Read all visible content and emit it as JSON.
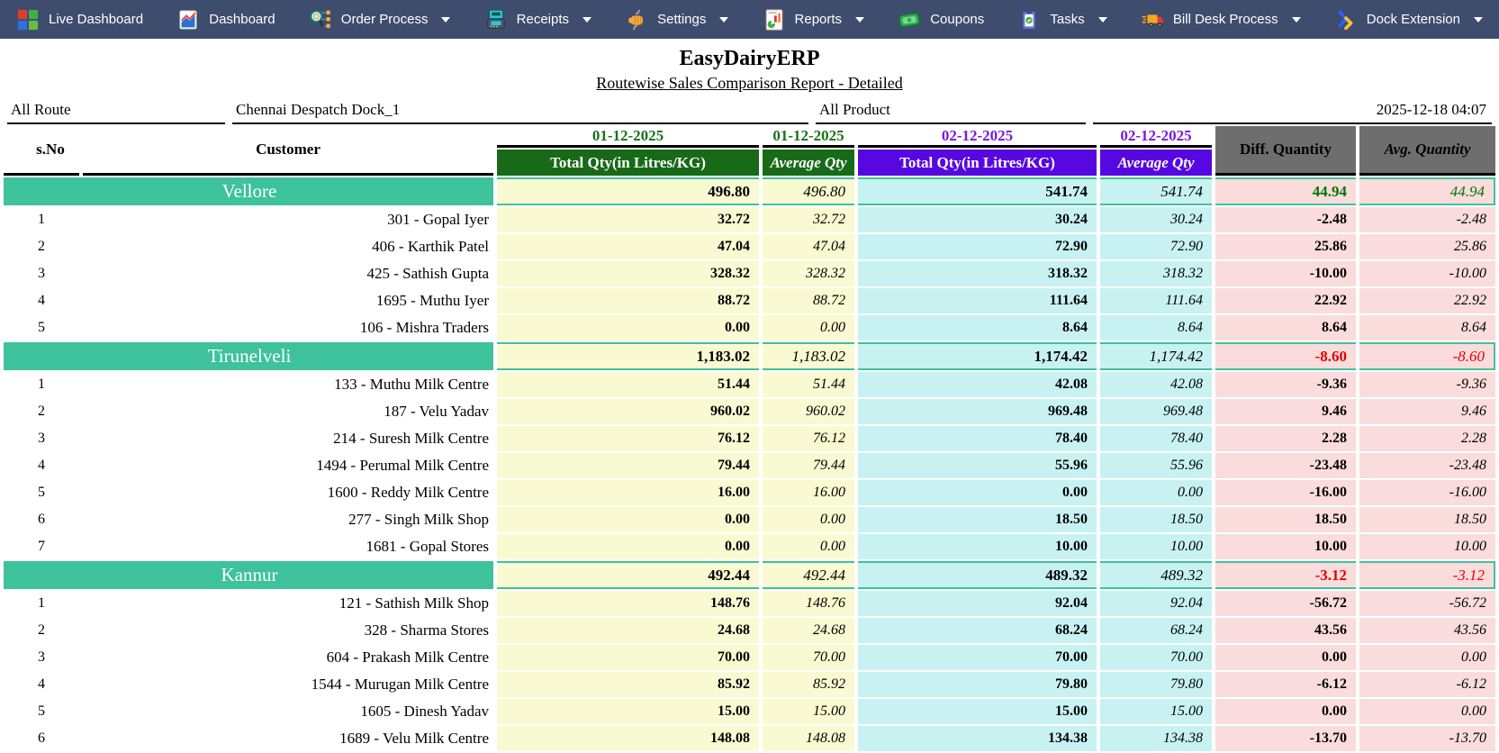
{
  "nav": {
    "items": [
      {
        "label": "Live Dashboard",
        "icon": "live-dashboard-icon",
        "caret": false
      },
      {
        "label": "Dashboard",
        "icon": "dashboard-icon",
        "caret": false
      },
      {
        "label": "Order Process",
        "icon": "order-process-icon",
        "caret": true
      },
      {
        "label": "Receipts",
        "icon": "receipts-icon",
        "caret": true
      },
      {
        "label": "Settings",
        "icon": "settings-icon",
        "caret": true
      },
      {
        "label": "Reports",
        "icon": "reports-icon",
        "caret": true
      },
      {
        "label": "Coupons",
        "icon": "coupons-icon",
        "caret": false
      },
      {
        "label": "Tasks",
        "icon": "tasks-icon",
        "caret": true
      },
      {
        "label": "Bill Desk Process",
        "icon": "bill-desk-icon",
        "caret": true
      },
      {
        "label": "Dock Extension",
        "icon": "dock-extension-icon",
        "caret": true
      }
    ]
  },
  "report": {
    "title": "EasyDairyERP",
    "subtitle": "Routewise Sales Comparison Report - Detailed",
    "filters": {
      "route": "All Route",
      "dock": "Chennai Despatch Dock_1",
      "product": "All Product",
      "datetime": "2025-12-18 04:07"
    },
    "table": {
      "headers": {
        "sno": "s.No",
        "customer": "Customer",
        "date1": "01-12-2025",
        "date2": "02-12-2025",
        "total_qty": "Total Qty(in Litres/KG)",
        "average_qty": "Average Qty",
        "diff_quantity": "Diff. Quantity",
        "avg_quantity": "Avg. Quantity"
      },
      "groups": [
        {
          "route": "Vellore",
          "totals": [
            "496.80",
            "496.80",
            "541.74",
            "541.74",
            "44.94",
            "44.94"
          ],
          "rows": [
            {
              "sno": "1",
              "customer": "301 - Gopal Iyer",
              "values": [
                "32.72",
                "32.72",
                "30.24",
                "30.24",
                "-2.48",
                "-2.48"
              ]
            },
            {
              "sno": "2",
              "customer": "406 - Karthik Patel",
              "values": [
                "47.04",
                "47.04",
                "72.90",
                "72.90",
                "25.86",
                "25.86"
              ]
            },
            {
              "sno": "3",
              "customer": "425 - Sathish Gupta",
              "values": [
                "328.32",
                "328.32",
                "318.32",
                "318.32",
                "-10.00",
                "-10.00"
              ]
            },
            {
              "sno": "4",
              "customer": "1695 - Muthu Iyer",
              "values": [
                "88.72",
                "88.72",
                "111.64",
                "111.64",
                "22.92",
                "22.92"
              ]
            },
            {
              "sno": "5",
              "customer": "106 - Mishra Traders",
              "values": [
                "0.00",
                "0.00",
                "8.64",
                "8.64",
                "8.64",
                "8.64"
              ]
            }
          ]
        },
        {
          "route": "Tirunelveli",
          "totals": [
            "1,183.02",
            "1,183.02",
            "1,174.42",
            "1,174.42",
            "-8.60",
            "-8.60"
          ],
          "rows": [
            {
              "sno": "1",
              "customer": "133 - Muthu Milk Centre",
              "values": [
                "51.44",
                "51.44",
                "42.08",
                "42.08",
                "-9.36",
                "-9.36"
              ]
            },
            {
              "sno": "2",
              "customer": "187 - Velu Yadav",
              "values": [
                "960.02",
                "960.02",
                "969.48",
                "969.48",
                "9.46",
                "9.46"
              ]
            },
            {
              "sno": "3",
              "customer": "214 - Suresh Milk Centre",
              "values": [
                "76.12",
                "76.12",
                "78.40",
                "78.40",
                "2.28",
                "2.28"
              ]
            },
            {
              "sno": "4",
              "customer": "1494 - Perumal Milk Centre",
              "values": [
                "79.44",
                "79.44",
                "55.96",
                "55.96",
                "-23.48",
                "-23.48"
              ]
            },
            {
              "sno": "5",
              "customer": "1600 - Reddy Milk Centre",
              "values": [
                "16.00",
                "16.00",
                "0.00",
                "0.00",
                "-16.00",
                "-16.00"
              ]
            },
            {
              "sno": "6",
              "customer": "277 - Singh Milk Shop",
              "values": [
                "0.00",
                "0.00",
                "18.50",
                "18.50",
                "18.50",
                "18.50"
              ]
            },
            {
              "sno": "7",
              "customer": "1681 - Gopal Stores",
              "values": [
                "0.00",
                "0.00",
                "10.00",
                "10.00",
                "10.00",
                "10.00"
              ]
            }
          ]
        },
        {
          "route": "Kannur",
          "totals": [
            "492.44",
            "492.44",
            "489.32",
            "489.32",
            "-3.12",
            "-3.12"
          ],
          "rows": [
            {
              "sno": "1",
              "customer": "121 - Sathish Milk Shop",
              "values": [
                "148.76",
                "148.76",
                "92.04",
                "92.04",
                "-56.72",
                "-56.72"
              ]
            },
            {
              "sno": "2",
              "customer": "328 - Sharma Stores",
              "values": [
                "24.68",
                "24.68",
                "68.24",
                "68.24",
                "43.56",
                "43.56"
              ]
            },
            {
              "sno": "3",
              "customer": "604 - Prakash Milk Centre",
              "values": [
                "70.00",
                "70.00",
                "70.00",
                "70.00",
                "0.00",
                "0.00"
              ]
            },
            {
              "sno": "4",
              "customer": "1544 - Murugan Milk Centre",
              "values": [
                "85.92",
                "85.92",
                "79.80",
                "79.80",
                "-6.12",
                "-6.12"
              ]
            },
            {
              "sno": "5",
              "customer": "1605 - Dinesh Yadav",
              "values": [
                "15.00",
                "15.00",
                "15.00",
                "15.00",
                "0.00",
                "0.00"
              ]
            },
            {
              "sno": "6",
              "customer": "1689 - Velu Milk Centre",
              "values": [
                "148.08",
                "148.08",
                "134.38",
                "134.38",
                "-13.70",
                "-13.70"
              ]
            }
          ]
        }
      ]
    }
  },
  "colors": {
    "nav_bg": "#3E4C6D",
    "header_green_bg": "#186A18",
    "date1_text": "#187218",
    "header_violet_bg": "#5708E0",
    "date2_text": "#7B16E3",
    "header_gray_bg": "#6E6E6E",
    "group_teal": "#3EC29B",
    "day1_cell_bg": "#FAFAD2",
    "day2_cell_bg": "#C8F2F2",
    "diff_cell_bg": "#FADCDC",
    "positive_value": "#007800",
    "negative_value": "#E50000"
  }
}
